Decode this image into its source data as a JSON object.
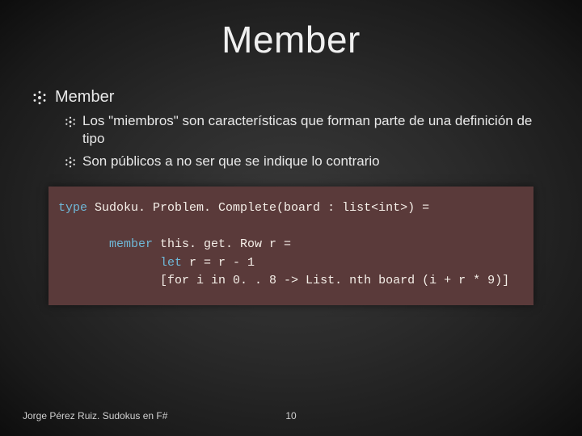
{
  "title": "Member",
  "bullets": {
    "l1": "Member",
    "l2a": "Los \"miembros\" son características que forman parte de una definición de tipo",
    "l2b": "Son públicos a no ser que se indique lo contrario"
  },
  "code": {
    "kw_type": "type",
    "line1_rest": " Sudoku. Problem. Complete(board : list<int>) =",
    "kw_member": "member",
    "line3_rest": " this. get. Row r =",
    "kw_let": "let",
    "line4_rest": " r = r - 1",
    "line5": "[for i in 0. . 8 -> List. nth board (i + r * 9)]"
  },
  "footer": {
    "author": "Jorge Pérez Ruiz. Sudokus en F#",
    "page": "10"
  }
}
